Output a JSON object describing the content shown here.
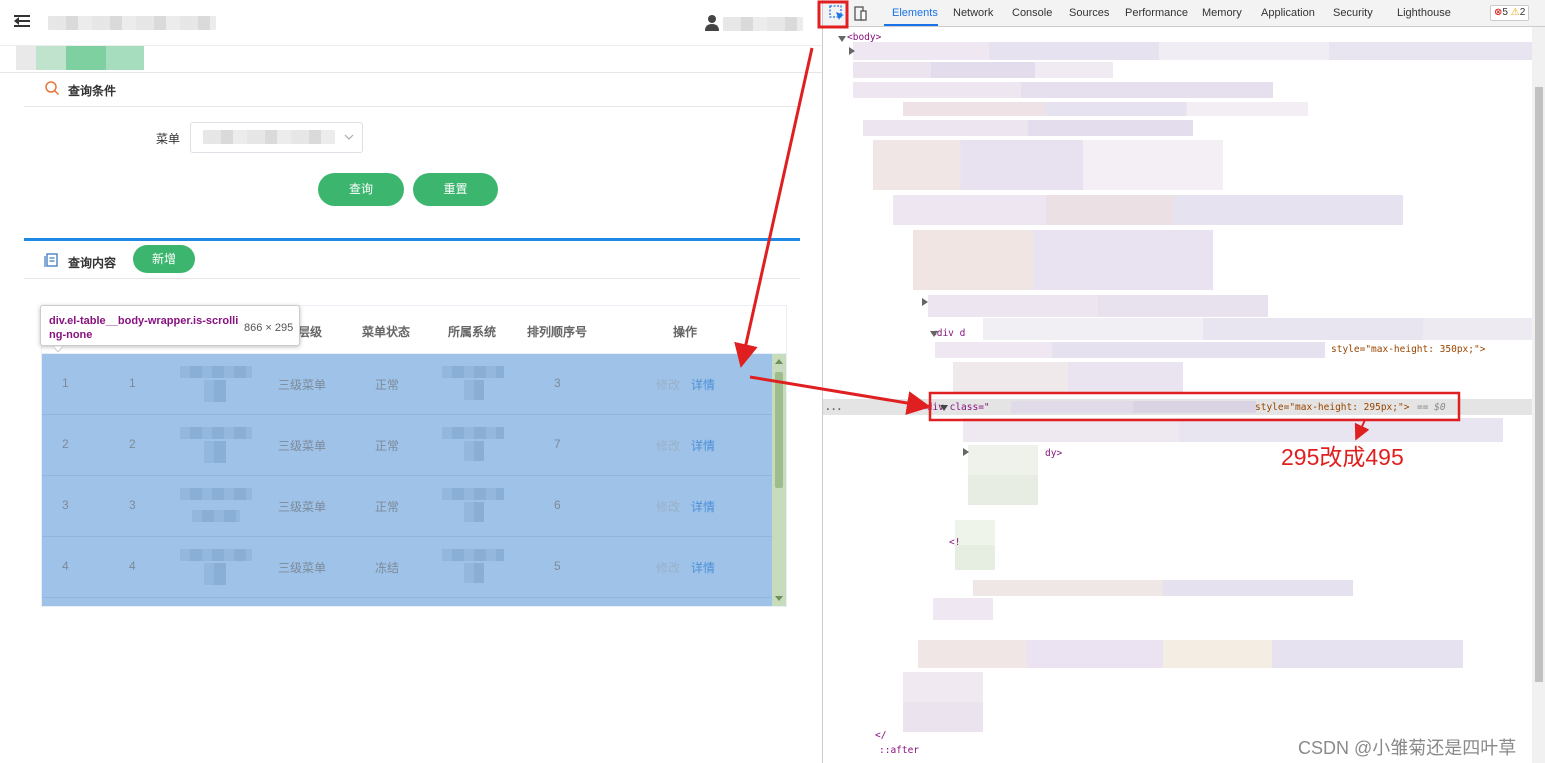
{
  "app": {
    "query_section": {
      "title": "查询条件"
    },
    "form": {
      "menu_label": "菜单"
    },
    "buttons": {
      "search": "查询",
      "reset": "重置",
      "add": "新增"
    },
    "content_section": {
      "title": "查询内容"
    },
    "table": {
      "headers": [
        "层级",
        "菜单状态",
        "所属系统",
        "排列顺序号",
        "操作"
      ],
      "rows": [
        {
          "col1": "1",
          "col2": "1",
          "level": "三级菜单",
          "status": "正常",
          "order": "3",
          "edit": "修改",
          "detail": "详情"
        },
        {
          "col1": "2",
          "col2": "2",
          "level": "三级菜单",
          "status": "正常",
          "order": "7",
          "edit": "修改",
          "detail": "详情"
        },
        {
          "col1": "3",
          "col2": "3",
          "level": "三级菜单",
          "status": "正常",
          "order": "6",
          "edit": "修改",
          "detail": "详情"
        },
        {
          "col1": "4",
          "col2": "4",
          "level": "三级菜单",
          "status": "冻结",
          "order": "5",
          "edit": "修改",
          "detail": "详情"
        }
      ]
    },
    "tooltip": {
      "selector": "div.el-table__body-wrapper.is-scrolling-none",
      "size": "866 × 295"
    }
  },
  "devtools": {
    "tabs": [
      "Elements",
      "Network",
      "Console",
      "Sources",
      "Performance",
      "Memory",
      "Application",
      "Security",
      "Lighthouse"
    ],
    "active_tab": "Elements",
    "errors": "5",
    "warnings": "2",
    "code": {
      "body": "<body>",
      "div_open": "<div d",
      "style_350": "style=\"max-height: 350px;\">",
      "div_class": "<div class=\"",
      "style_295": "style=\"max-height: 295px;\">",
      "dollar0": "== $0",
      "dy": "dy>",
      "comment": "<!",
      "close_tag": "</",
      "after": "::after",
      "dots": "..."
    }
  },
  "annotations": {
    "note": "295改成495",
    "watermark": "CSDN @小雏菊还是四叶草"
  },
  "colors": {
    "green": "#3cb66f",
    "blue": "#1e88e5",
    "red": "#e02020",
    "selection": "#9fc3e8"
  }
}
